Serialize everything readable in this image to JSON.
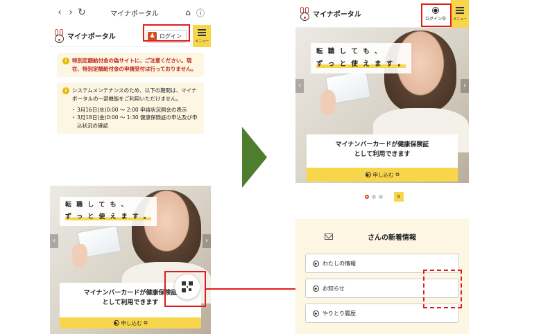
{
  "left": {
    "browser": {
      "back": "‹",
      "forward": "›",
      "reload": "↻",
      "title": "マイナポータル",
      "home": "⌂",
      "info": "ⓘ"
    },
    "header": {
      "logo_text": "マイナポータル",
      "login_label": "ログイン",
      "menu_label": "メニュー"
    },
    "notice_alert": "特別定額給付金の偽サイトに、ご注意ください。現在、特別定額給付金の申請受付は行っておりません。",
    "notice_maintenance": {
      "text": "システムメンテナンスのため、以下の期間は、マイナポータルの一部機能をご利用いただけません。",
      "items": [
        "3月16日(水)0:00 〜 2:00 申請状況照会の表示",
        "3月18日(金)0:00 〜 1:30 健康保険証の申込及び申込状況の確認"
      ]
    },
    "banner": {
      "catch_line1": "転 職 し て も 、",
      "catch_line2": "ず っ と 使 え ま す 。",
      "caption_line1": "マイナンバーカードが健康保険証",
      "caption_line2": "として利用できます",
      "apply_label": "申し込む"
    }
  },
  "right": {
    "header": {
      "logo_text": "マイナポータル",
      "login_label": "ログイン中",
      "menu_label": "メニュー"
    },
    "banner": {
      "catch_line1": "転 職 し て も 、",
      "catch_line2": "ず っ と 使 え ま す 。",
      "caption_line1": "マイナンバーカードが健康保険証",
      "caption_line2": "として利用できます",
      "apply_label": "申し込む"
    },
    "pause_label": "II",
    "news": {
      "title": "さんの新着情報",
      "items": [
        "わたしの情報",
        "お知らせ",
        "やりとり履歴"
      ]
    }
  },
  "icons": {
    "info": "info-icon",
    "user": "user-icon",
    "menu": "hamburger-icon",
    "qr": "qr-code-icon",
    "mail": "mail-icon",
    "play": "play-circle-icon"
  },
  "colors": {
    "accent_yellow": "#f7d64b",
    "notice_bg": "#fdf6e3",
    "alert_red": "#c0271b",
    "highlight_red": "#e11b1b",
    "arrow_green": "#4e7d2e",
    "login_orange": "#d94b1f"
  }
}
